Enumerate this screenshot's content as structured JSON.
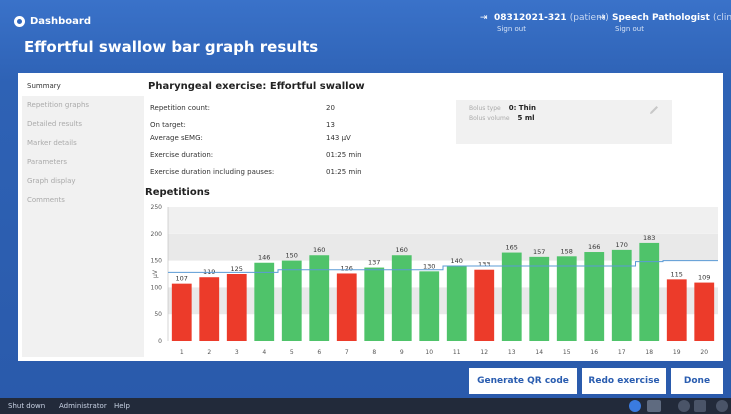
{
  "header": {
    "dashboard_label": "Dashboard",
    "page_title": "Effortful swallow bar graph results",
    "patient": {
      "icon": "sign-out-icon",
      "id": "08312021-321",
      "role": "(patient)",
      "signout": "Sign out"
    },
    "clinician": {
      "icon": "sign-out-icon",
      "name": "Speech Pathologist",
      "role": "(clinician",
      "signout": "Sign out"
    }
  },
  "sidebar": {
    "items": [
      {
        "label": "Summary",
        "active": true
      },
      {
        "label": "Repetition graphs"
      },
      {
        "label": "Detailed results"
      },
      {
        "label": "Marker details"
      },
      {
        "label": "Parameters"
      },
      {
        "label": "Graph display"
      },
      {
        "label": "Comments"
      }
    ]
  },
  "summary": {
    "title": "Pharyngeal exercise: Effortful swallow",
    "stats": [
      {
        "label": "Repetition count:",
        "value": "20"
      },
      {
        "label": "On target:",
        "value": "13"
      },
      {
        "label": "Average sEMG:",
        "value": "143 µV"
      },
      {
        "label": "Exercise duration:",
        "value": "01:25 min"
      },
      {
        "label": "Exercise duration including pauses:",
        "value": "01:25 min"
      }
    ],
    "bolus": {
      "type_label": "Bolus type",
      "type_value": "0: Thin",
      "volume_label": "Bolus volume",
      "volume_value": "5 ml",
      "edit_icon": "pencil-icon"
    }
  },
  "repetitions_title": "Repetitions",
  "chart_data": {
    "type": "bar",
    "ylabel": "µV",
    "ylim": [
      0,
      250
    ],
    "yticks": [
      0,
      50,
      100,
      150,
      200,
      250
    ],
    "categories": [
      "1",
      "2",
      "3",
      "4",
      "5",
      "6",
      "7",
      "8",
      "9",
      "10",
      "11",
      "12",
      "13",
      "14",
      "15",
      "16",
      "17",
      "18",
      "19",
      "20"
    ],
    "values": [
      107,
      119,
      125,
      146,
      150,
      160,
      126,
      137,
      160,
      130,
      140,
      133,
      165,
      157,
      158,
      166,
      170,
      183,
      115,
      109
    ],
    "on_target": [
      false,
      false,
      false,
      true,
      true,
      true,
      false,
      true,
      true,
      true,
      true,
      false,
      true,
      true,
      true,
      true,
      true,
      true,
      false,
      false
    ],
    "target_line": [
      128,
      128,
      128,
      128,
      133,
      133,
      133,
      133,
      133,
      133,
      140,
      140,
      140,
      140,
      140,
      140,
      140,
      148,
      150,
      150
    ],
    "colors": {
      "on_target": "#4fc36a",
      "off_target": "#ec3b2a",
      "target_line": "#5b9bd5",
      "band": "#e9e9e9"
    }
  },
  "footer": {
    "qr_label": "Generate QR code",
    "redo_label": "Redo exercise",
    "done_label": "Done"
  },
  "taskbar": {
    "shutdown": "Shut down",
    "user": "Administrator",
    "help": "Help"
  }
}
